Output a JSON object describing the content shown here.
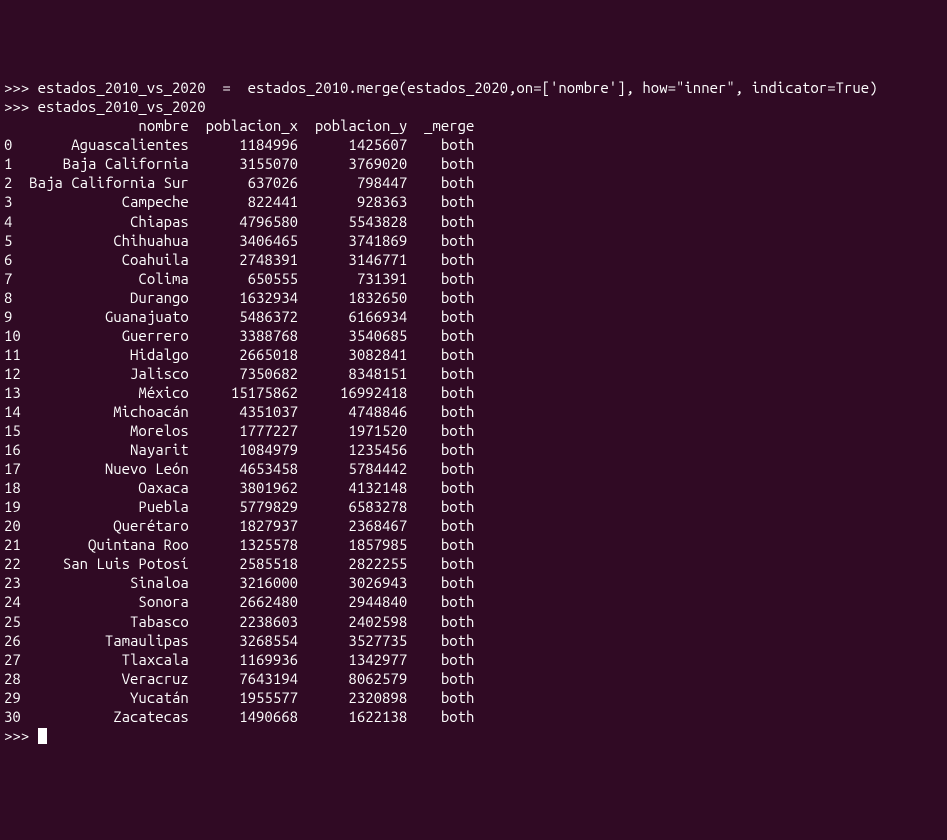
{
  "line1": ">>> estados_2010_vs_2020  =  estados_2010.merge(estados_2020,on=['nombre'], how=\"inner\", indicator=True)",
  "line2": ">>> estados_2010_vs_2020",
  "header": {
    "idx_pad": "  ",
    "nombre": "              nombre",
    "pob_x": "  poblacion_x",
    "pob_y": "  poblacion_y",
    "merge": "  _merge"
  },
  "rows": [
    {
      "idx": "0 ",
      "nombre": "      Aguascalientes",
      "px": "      1184996",
      "py": "      1425607",
      "mg": "    both"
    },
    {
      "idx": "1 ",
      "nombre": "     Baja California",
      "px": "      3155070",
      "py": "      3769020",
      "mg": "    both"
    },
    {
      "idx": "2 ",
      "nombre": " Baja California Sur",
      "px": "       637026",
      "py": "       798447",
      "mg": "    both"
    },
    {
      "idx": "3 ",
      "nombre": "            Campeche",
      "px": "       822441",
      "py": "       928363",
      "mg": "    both"
    },
    {
      "idx": "4 ",
      "nombre": "             Chiapas",
      "px": "      4796580",
      "py": "      5543828",
      "mg": "    both"
    },
    {
      "idx": "5 ",
      "nombre": "           Chihuahua",
      "px": "      3406465",
      "py": "      3741869",
      "mg": "    both"
    },
    {
      "idx": "6 ",
      "nombre": "            Coahuila",
      "px": "      2748391",
      "py": "      3146771",
      "mg": "    both"
    },
    {
      "idx": "7 ",
      "nombre": "              Colima",
      "px": "       650555",
      "py": "       731391",
      "mg": "    both"
    },
    {
      "idx": "8 ",
      "nombre": "             Durango",
      "px": "      1632934",
      "py": "      1832650",
      "mg": "    both"
    },
    {
      "idx": "9 ",
      "nombre": "          Guanajuato",
      "px": "      5486372",
      "py": "      6166934",
      "mg": "    both"
    },
    {
      "idx": "10",
      "nombre": "            Guerrero",
      "px": "      3388768",
      "py": "      3540685",
      "mg": "    both"
    },
    {
      "idx": "11",
      "nombre": "             Hidalgo",
      "px": "      2665018",
      "py": "      3082841",
      "mg": "    both"
    },
    {
      "idx": "12",
      "nombre": "             Jalisco",
      "px": "      7350682",
      "py": "      8348151",
      "mg": "    both"
    },
    {
      "idx": "13",
      "nombre": "              México",
      "px": "     15175862",
      "py": "     16992418",
      "mg": "    both"
    },
    {
      "idx": "14",
      "nombre": "           Michoacán",
      "px": "      4351037",
      "py": "      4748846",
      "mg": "    both"
    },
    {
      "idx": "15",
      "nombre": "             Morelos",
      "px": "      1777227",
      "py": "      1971520",
      "mg": "    both"
    },
    {
      "idx": "16",
      "nombre": "             Nayarit",
      "px": "      1084979",
      "py": "      1235456",
      "mg": "    both"
    },
    {
      "idx": "17",
      "nombre": "          Nuevo León",
      "px": "      4653458",
      "py": "      5784442",
      "mg": "    both"
    },
    {
      "idx": "18",
      "nombre": "              Oaxaca",
      "px": "      3801962",
      "py": "      4132148",
      "mg": "    both"
    },
    {
      "idx": "19",
      "nombre": "              Puebla",
      "px": "      5779829",
      "py": "      6583278",
      "mg": "    both"
    },
    {
      "idx": "20",
      "nombre": "           Querétaro",
      "px": "      1827937",
      "py": "      2368467",
      "mg": "    both"
    },
    {
      "idx": "21",
      "nombre": "        Quintana Roo",
      "px": "      1325578",
      "py": "      1857985",
      "mg": "    both"
    },
    {
      "idx": "22",
      "nombre": "     San Luis Potosí",
      "px": "      2585518",
      "py": "      2822255",
      "mg": "    both"
    },
    {
      "idx": "23",
      "nombre": "             Sinaloa",
      "px": "      3216000",
      "py": "      3026943",
      "mg": "    both"
    },
    {
      "idx": "24",
      "nombre": "              Sonora",
      "px": "      2662480",
      "py": "      2944840",
      "mg": "    both"
    },
    {
      "idx": "25",
      "nombre": "             Tabasco",
      "px": "      2238603",
      "py": "      2402598",
      "mg": "    both"
    },
    {
      "idx": "26",
      "nombre": "          Tamaulipas",
      "px": "      3268554",
      "py": "      3527735",
      "mg": "    both"
    },
    {
      "idx": "27",
      "nombre": "            Tlaxcala",
      "px": "      1169936",
      "py": "      1342977",
      "mg": "    both"
    },
    {
      "idx": "28",
      "nombre": "            Veracruz",
      "px": "      7643194",
      "py": "      8062579",
      "mg": "    both"
    },
    {
      "idx": "29",
      "nombre": "             Yucatán",
      "px": "      1955577",
      "py": "      2320898",
      "mg": "    both"
    },
    {
      "idx": "30",
      "nombre": "           Zacatecas",
      "px": "      1490668",
      "py": "      1622138",
      "mg": "    both"
    }
  ],
  "prompt3": ">>> "
}
